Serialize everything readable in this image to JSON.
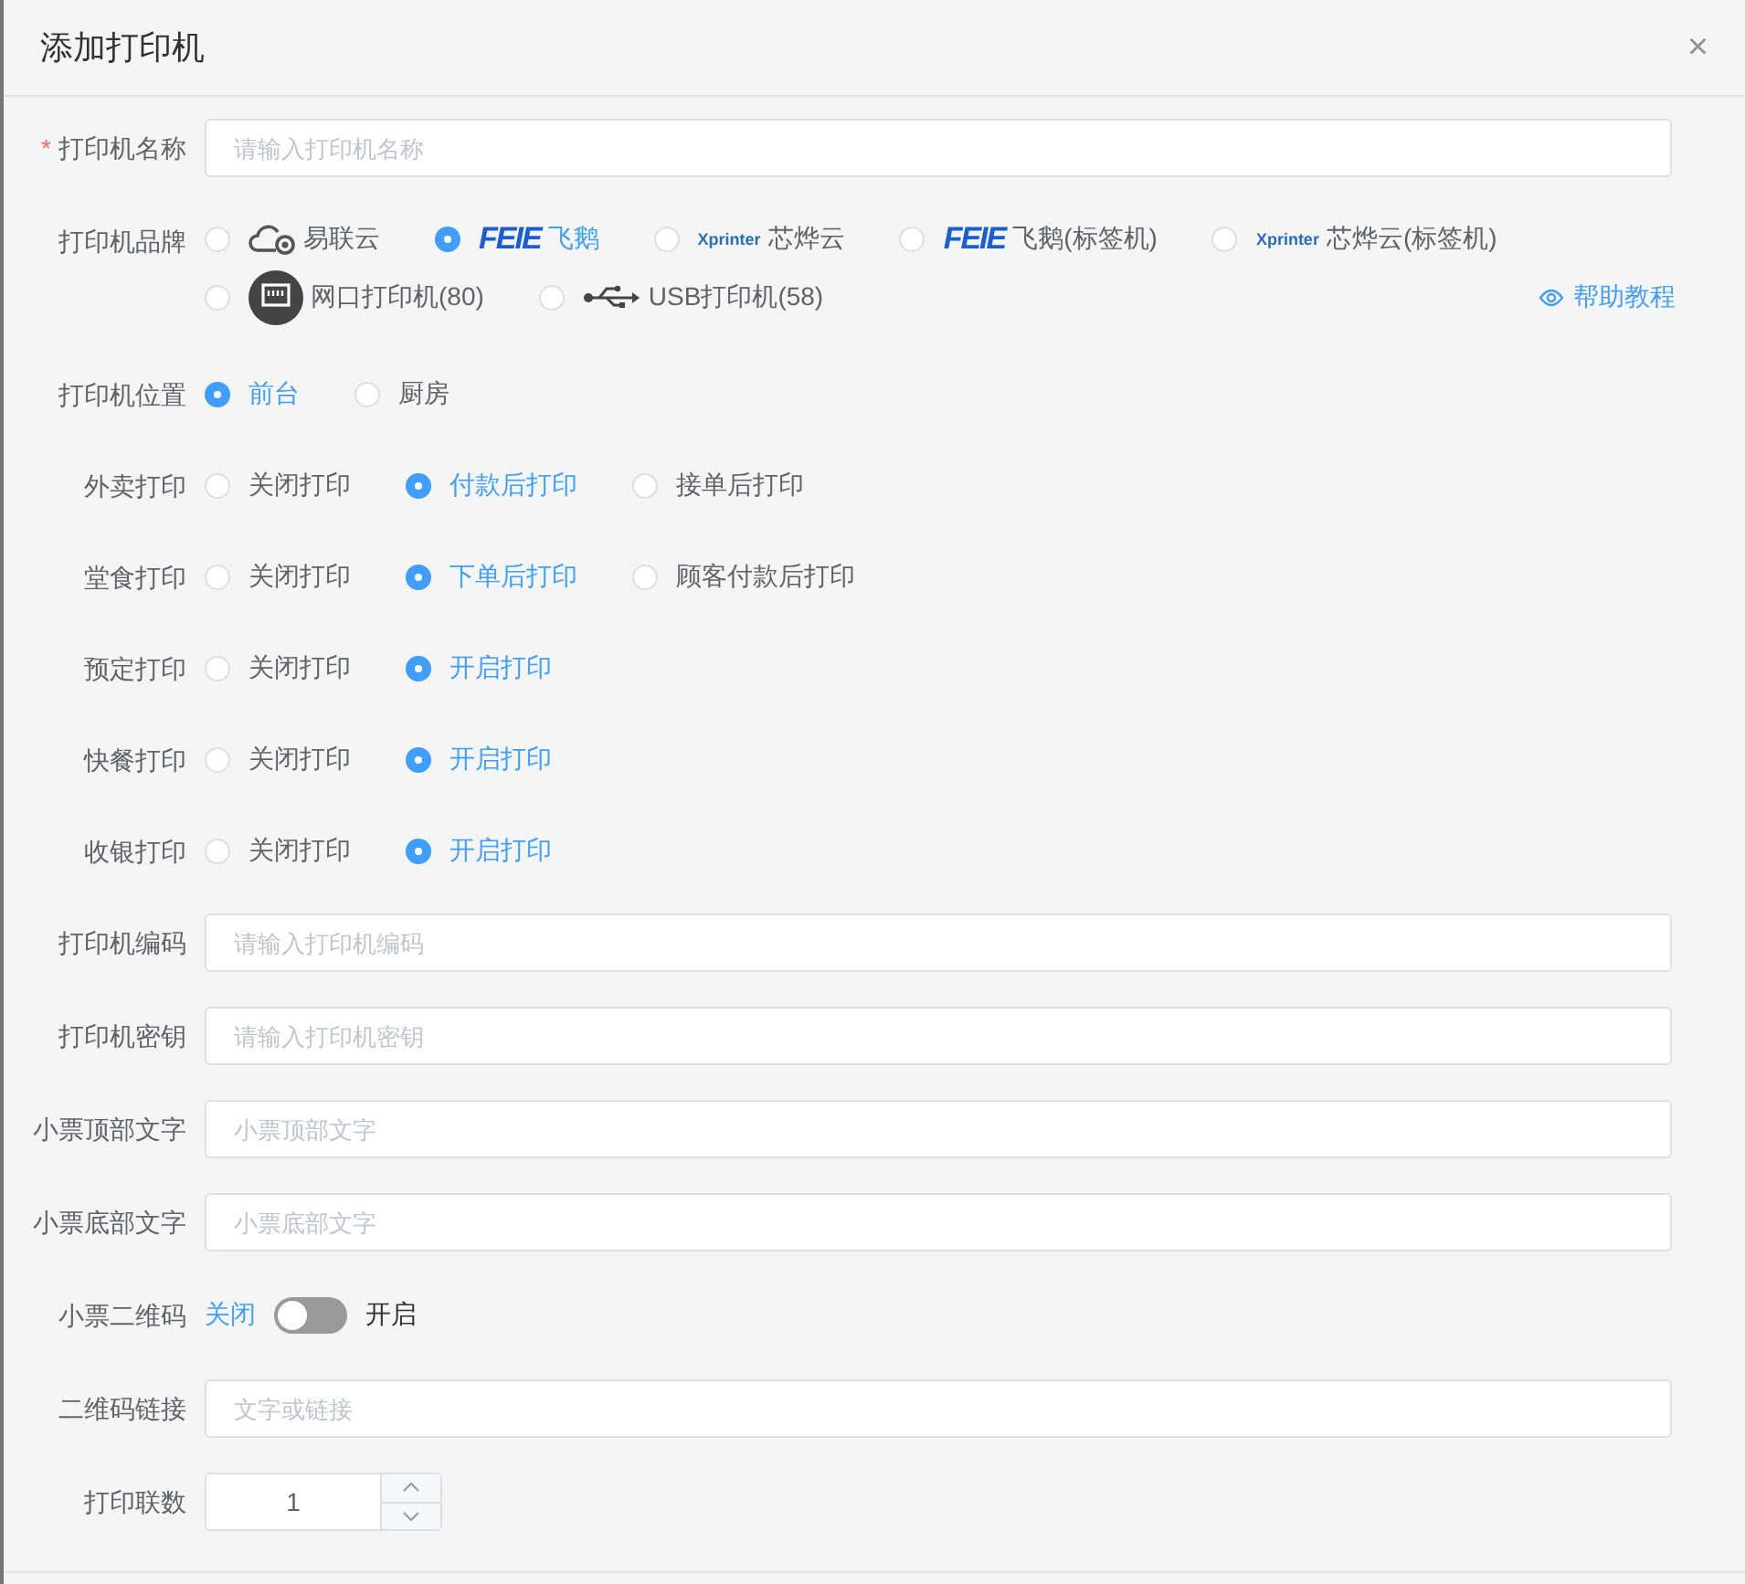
{
  "dialog": {
    "title": "添加打印机",
    "close": "×"
  },
  "rows": [
    {
      "kind": "input",
      "label": "打印机名称",
      "required_mark": "*",
      "placeholder": "请输入打印机名称"
    },
    {
      "kind": "brand",
      "label": "打印机品牌",
      "options": [
        {
          "kind": "cloud",
          "label": "易联云",
          "selected": false
        },
        {
          "kind": "feie",
          "logo": "FEIE",
          "label": "飞鹅",
          "selected": true
        },
        {
          "kind": "xprinter",
          "logo": "Xprinter",
          "label": "芯烨云",
          "selected": false
        },
        {
          "kind": "feie",
          "logo": "FEIE",
          "label": "飞鹅(标签机)",
          "selected": false
        },
        {
          "kind": "xprinter",
          "logo": "Xprinter",
          "label": "芯烨云(标签机)",
          "selected": false
        },
        {
          "kind": "network",
          "label": "网口打印机(80)",
          "selected": false
        },
        {
          "kind": "usb",
          "label": "USB打印机(58)",
          "selected": false
        }
      ],
      "help": "帮助教程"
    },
    {
      "kind": "radio",
      "label": "打印机位置",
      "options": [
        {
          "label": "前台",
          "selected": true
        },
        {
          "label": "厨房",
          "selected": false
        }
      ]
    },
    {
      "kind": "radio",
      "label": "外卖打印",
      "options": [
        {
          "label": "关闭打印",
          "selected": false
        },
        {
          "label": "付款后打印",
          "selected": true
        },
        {
          "label": "接单后打印",
          "selected": false
        }
      ]
    },
    {
      "kind": "radio",
      "label": "堂食打印",
      "options": [
        {
          "label": "关闭打印",
          "selected": false
        },
        {
          "label": "下单后打印",
          "selected": true
        },
        {
          "label": "顾客付款后打印",
          "selected": false
        }
      ]
    },
    {
      "kind": "radio",
      "label": "预定打印",
      "options": [
        {
          "label": "关闭打印",
          "selected": false
        },
        {
          "label": "开启打印",
          "selected": true
        }
      ]
    },
    {
      "kind": "radio",
      "label": "快餐打印",
      "options": [
        {
          "label": "关闭打印",
          "selected": false
        },
        {
          "label": "开启打印",
          "selected": true
        }
      ]
    },
    {
      "kind": "radio",
      "label": "收银打印",
      "options": [
        {
          "label": "关闭打印",
          "selected": false
        },
        {
          "label": "开启打印",
          "selected": true
        }
      ]
    },
    {
      "kind": "input",
      "label": "打印机编码",
      "placeholder": "请输入打印机编码"
    },
    {
      "kind": "input",
      "label": "打印机密钥",
      "placeholder": "请输入打印机密钥"
    },
    {
      "kind": "input",
      "label": "小票顶部文字",
      "placeholder": "小票顶部文字"
    },
    {
      "kind": "input",
      "label": "小票底部文字",
      "placeholder": "小票底部文字"
    },
    {
      "kind": "switch",
      "label": "小票二维码",
      "off_label": "关闭",
      "on_label": "开启",
      "on": false
    },
    {
      "kind": "input",
      "label": "二维码链接",
      "placeholder": "文字或链接"
    },
    {
      "kind": "number",
      "label": "打印联数",
      "value": "1"
    }
  ]
}
